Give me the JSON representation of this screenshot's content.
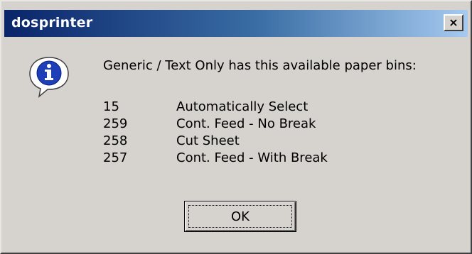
{
  "window": {
    "title": "dosprinter",
    "close_label": "×"
  },
  "dialog": {
    "icon": "information-icon",
    "message": "Generic / Text Only has this available paper bins:",
    "bins": [
      {
        "id": "15",
        "name": "Automatically Select"
      },
      {
        "id": "259",
        "name": "Cont. Feed - No Break"
      },
      {
        "id": "258",
        "name": "Cut Sheet"
      },
      {
        "id": "257",
        "name": "Cont. Feed - With Break"
      }
    ],
    "ok_label": "OK"
  },
  "colors": {
    "titlebar_start": "#0a246a",
    "titlebar_end": "#a6caf0",
    "dialog_face": "#d6d3ce",
    "icon_blue": "#1f3fb8"
  }
}
